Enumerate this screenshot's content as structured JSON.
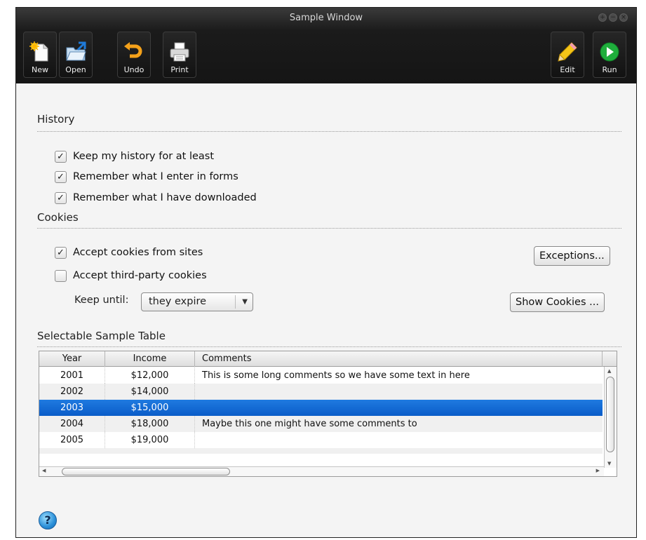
{
  "window": {
    "title": "Sample Window"
  },
  "window_controls": [
    "+",
    "−",
    "×"
  ],
  "toolbar": {
    "left": [
      {
        "label": "New",
        "icon": "new-document-icon"
      },
      {
        "label": "Open",
        "icon": "open-folder-icon"
      },
      {
        "label": "Undo",
        "icon": "undo-icon"
      },
      {
        "label": "Print",
        "icon": "printer-icon"
      }
    ],
    "right": [
      {
        "label": "Edit",
        "icon": "pencil-icon"
      },
      {
        "label": "Run",
        "icon": "play-icon"
      }
    ]
  },
  "history": {
    "title": "History",
    "options": [
      {
        "label": "Keep my history for at least",
        "checked": true,
        "mark": "✓"
      },
      {
        "label": "Remember what I enter in forms",
        "checked": true,
        "mark": "✓"
      },
      {
        "label": "Remember what I have downloaded",
        "checked": true,
        "mark": "✓"
      }
    ]
  },
  "cookies": {
    "title": "Cookies",
    "accept_sites": {
      "label": "Accept cookies from sites",
      "checked": true,
      "mark": "✓"
    },
    "accept_third_party": {
      "label": "Accept third-party cookies",
      "checked": false,
      "mark": ""
    },
    "exceptions_button": "Exceptions...",
    "keep_until_label": "Keep until:",
    "keep_until_value": "they expire",
    "show_cookies_button": "Show Cookies ..."
  },
  "table": {
    "title": "Selectable Sample Table",
    "columns": [
      "Year",
      "Income",
      "Comments"
    ],
    "rows": [
      {
        "year": "2001",
        "income": "$12,000",
        "comments": "This is some long comments so we have some text in here"
      },
      {
        "year": "2002",
        "income": "$14,000",
        "comments": ""
      },
      {
        "year": "2003",
        "income": "$15,000",
        "comments": "",
        "selected": true
      },
      {
        "year": "2004",
        "income": "$18,000",
        "comments": "Maybe this one might have some comments to"
      },
      {
        "year": "2005",
        "income": "$19,000",
        "comments": ""
      }
    ]
  },
  "help": {
    "label": "?"
  },
  "colors": {
    "selection": "#0a64d6",
    "toolbar": "#1b1b1b"
  }
}
